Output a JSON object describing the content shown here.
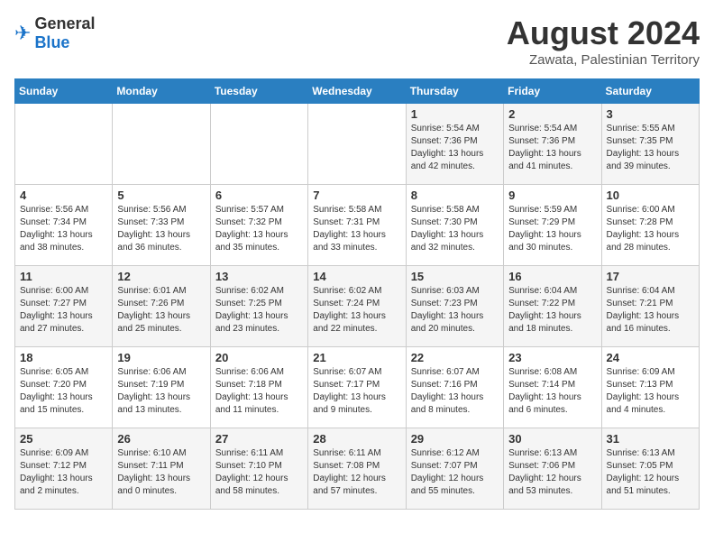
{
  "logo": {
    "general": "General",
    "blue": "Blue"
  },
  "title": {
    "month_year": "August 2024",
    "location": "Zawata, Palestinian Territory"
  },
  "weekdays": [
    "Sunday",
    "Monday",
    "Tuesday",
    "Wednesday",
    "Thursday",
    "Friday",
    "Saturday"
  ],
  "weeks": [
    [
      {
        "day": "",
        "info": ""
      },
      {
        "day": "",
        "info": ""
      },
      {
        "day": "",
        "info": ""
      },
      {
        "day": "",
        "info": ""
      },
      {
        "day": "1",
        "info": "Sunrise: 5:54 AM\nSunset: 7:36 PM\nDaylight: 13 hours\nand 42 minutes."
      },
      {
        "day": "2",
        "info": "Sunrise: 5:54 AM\nSunset: 7:36 PM\nDaylight: 13 hours\nand 41 minutes."
      },
      {
        "day": "3",
        "info": "Sunrise: 5:55 AM\nSunset: 7:35 PM\nDaylight: 13 hours\nand 39 minutes."
      }
    ],
    [
      {
        "day": "4",
        "info": "Sunrise: 5:56 AM\nSunset: 7:34 PM\nDaylight: 13 hours\nand 38 minutes."
      },
      {
        "day": "5",
        "info": "Sunrise: 5:56 AM\nSunset: 7:33 PM\nDaylight: 13 hours\nand 36 minutes."
      },
      {
        "day": "6",
        "info": "Sunrise: 5:57 AM\nSunset: 7:32 PM\nDaylight: 13 hours\nand 35 minutes."
      },
      {
        "day": "7",
        "info": "Sunrise: 5:58 AM\nSunset: 7:31 PM\nDaylight: 13 hours\nand 33 minutes."
      },
      {
        "day": "8",
        "info": "Sunrise: 5:58 AM\nSunset: 7:30 PM\nDaylight: 13 hours\nand 32 minutes."
      },
      {
        "day": "9",
        "info": "Sunrise: 5:59 AM\nSunset: 7:29 PM\nDaylight: 13 hours\nand 30 minutes."
      },
      {
        "day": "10",
        "info": "Sunrise: 6:00 AM\nSunset: 7:28 PM\nDaylight: 13 hours\nand 28 minutes."
      }
    ],
    [
      {
        "day": "11",
        "info": "Sunrise: 6:00 AM\nSunset: 7:27 PM\nDaylight: 13 hours\nand 27 minutes."
      },
      {
        "day": "12",
        "info": "Sunrise: 6:01 AM\nSunset: 7:26 PM\nDaylight: 13 hours\nand 25 minutes."
      },
      {
        "day": "13",
        "info": "Sunrise: 6:02 AM\nSunset: 7:25 PM\nDaylight: 13 hours\nand 23 minutes."
      },
      {
        "day": "14",
        "info": "Sunrise: 6:02 AM\nSunset: 7:24 PM\nDaylight: 13 hours\nand 22 minutes."
      },
      {
        "day": "15",
        "info": "Sunrise: 6:03 AM\nSunset: 7:23 PM\nDaylight: 13 hours\nand 20 minutes."
      },
      {
        "day": "16",
        "info": "Sunrise: 6:04 AM\nSunset: 7:22 PM\nDaylight: 13 hours\nand 18 minutes."
      },
      {
        "day": "17",
        "info": "Sunrise: 6:04 AM\nSunset: 7:21 PM\nDaylight: 13 hours\nand 16 minutes."
      }
    ],
    [
      {
        "day": "18",
        "info": "Sunrise: 6:05 AM\nSunset: 7:20 PM\nDaylight: 13 hours\nand 15 minutes."
      },
      {
        "day": "19",
        "info": "Sunrise: 6:06 AM\nSunset: 7:19 PM\nDaylight: 13 hours\nand 13 minutes."
      },
      {
        "day": "20",
        "info": "Sunrise: 6:06 AM\nSunset: 7:18 PM\nDaylight: 13 hours\nand 11 minutes."
      },
      {
        "day": "21",
        "info": "Sunrise: 6:07 AM\nSunset: 7:17 PM\nDaylight: 13 hours\nand 9 minutes."
      },
      {
        "day": "22",
        "info": "Sunrise: 6:07 AM\nSunset: 7:16 PM\nDaylight: 13 hours\nand 8 minutes."
      },
      {
        "day": "23",
        "info": "Sunrise: 6:08 AM\nSunset: 7:14 PM\nDaylight: 13 hours\nand 6 minutes."
      },
      {
        "day": "24",
        "info": "Sunrise: 6:09 AM\nSunset: 7:13 PM\nDaylight: 13 hours\nand 4 minutes."
      }
    ],
    [
      {
        "day": "25",
        "info": "Sunrise: 6:09 AM\nSunset: 7:12 PM\nDaylight: 13 hours\nand 2 minutes."
      },
      {
        "day": "26",
        "info": "Sunrise: 6:10 AM\nSunset: 7:11 PM\nDaylight: 13 hours\nand 0 minutes."
      },
      {
        "day": "27",
        "info": "Sunrise: 6:11 AM\nSunset: 7:10 PM\nDaylight: 12 hours\nand 58 minutes."
      },
      {
        "day": "28",
        "info": "Sunrise: 6:11 AM\nSunset: 7:08 PM\nDaylight: 12 hours\nand 57 minutes."
      },
      {
        "day": "29",
        "info": "Sunrise: 6:12 AM\nSunset: 7:07 PM\nDaylight: 12 hours\nand 55 minutes."
      },
      {
        "day": "30",
        "info": "Sunrise: 6:13 AM\nSunset: 7:06 PM\nDaylight: 12 hours\nand 53 minutes."
      },
      {
        "day": "31",
        "info": "Sunrise: 6:13 AM\nSunset: 7:05 PM\nDaylight: 12 hours\nand 51 minutes."
      }
    ]
  ]
}
